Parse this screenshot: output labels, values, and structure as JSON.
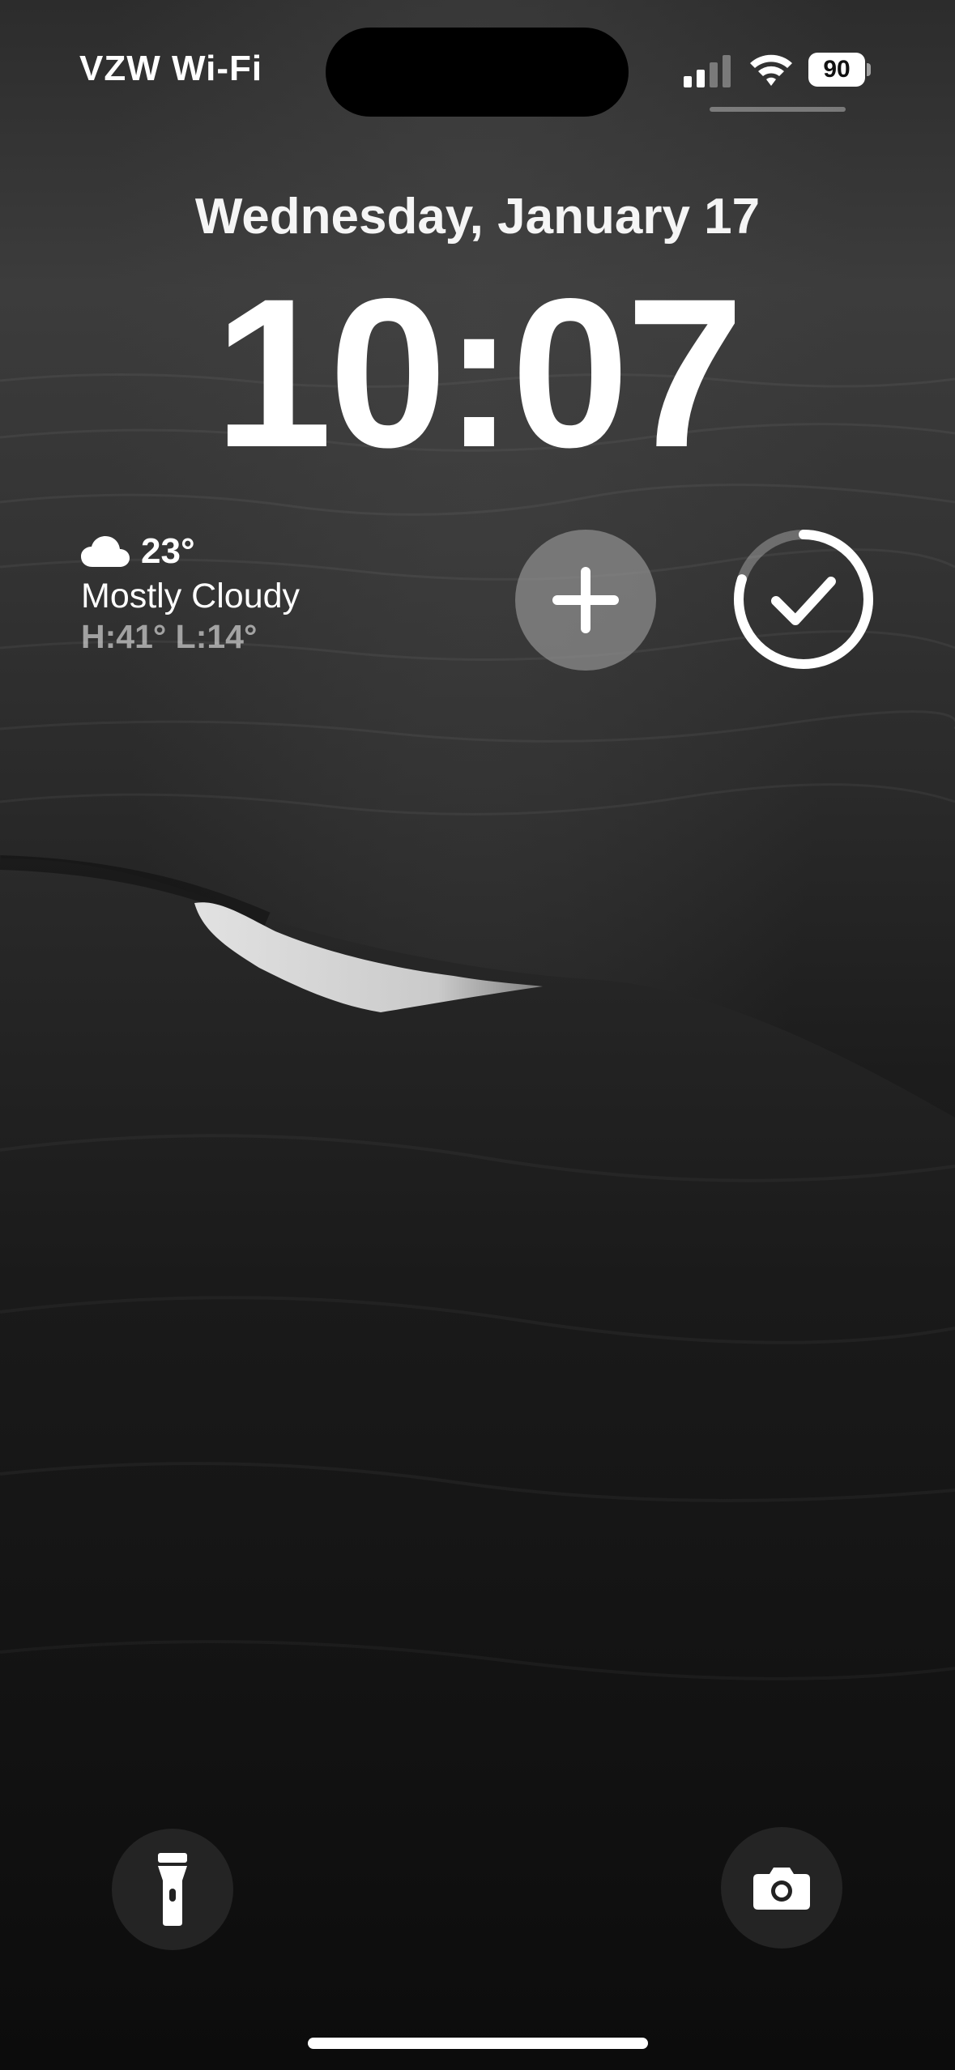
{
  "status_bar": {
    "carrier": "VZW Wi-Fi",
    "battery_level": "90",
    "signal_bars_active": 2,
    "signal_bars_total": 4
  },
  "lock_screen": {
    "date": "Wednesday, January 17",
    "time": "10:07"
  },
  "weather_widget": {
    "icon": "cloud-icon",
    "temperature": "23°",
    "condition": "Mostly Cloudy",
    "high_low": "H:41° L:14°"
  },
  "widgets": {
    "add_icon": "plus-icon",
    "reminder_icon": "checkmark-icon",
    "reminder_progress": 0.8
  },
  "quick_actions": {
    "left_icon": "flashlight-icon",
    "right_icon": "camera-icon"
  },
  "colors": {
    "text": "#ffffff",
    "widget_bg": "#8c8c8c"
  }
}
